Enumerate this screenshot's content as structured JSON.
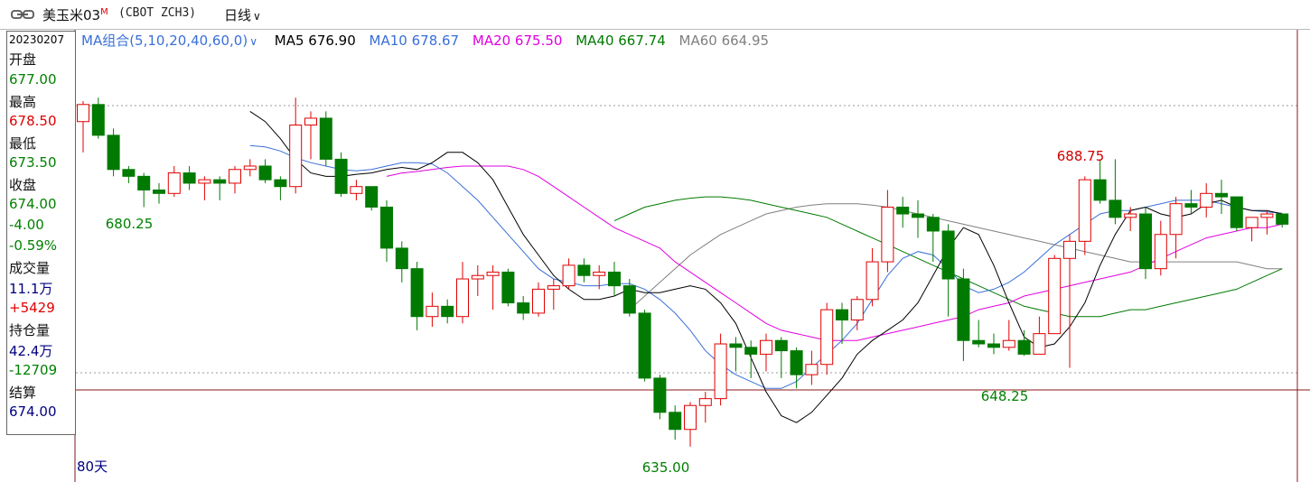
{
  "header": {
    "title": "美玉米03",
    "title_mark": "M",
    "code": "(CBOT ZCH3)",
    "period": "日线"
  },
  "info_panel": {
    "date": "20230207",
    "open_label": "开盘",
    "open": "677.00",
    "high_label": "最高",
    "high": "678.50",
    "low_label": "最低",
    "low": "673.50",
    "close_label": "收盘",
    "close": "674.00",
    "change": "-4.00",
    "change_pct": "-0.59%",
    "volume_label": "成交量",
    "volume": "11.1万",
    "volume_change": "+5429",
    "oi_label": "持仓量",
    "oi": "42.4万",
    "oi_change": "-12709",
    "settle_label": "结算",
    "settle": "674.00"
  },
  "ma_legend": {
    "group": "MA组合(5,10,20,40,60,0)",
    "ma5": "MA5 676.90",
    "ma10": "MA10 678.67",
    "ma20": "MA20 675.50",
    "ma40": "MA40 667.74",
    "ma60": "MA60 664.95"
  },
  "colors": {
    "up": "#e00000",
    "down": "#007a00",
    "ma5": "#000000",
    "ma10": "#3a6fd8",
    "ma20": "#e000e0",
    "ma40": "#007a00",
    "ma60": "#808080",
    "value_green": "#008000",
    "value_red": "#e00000",
    "value_blue": "#000080"
  },
  "chart_data": {
    "type": "candlestick",
    "ylim": [
      631,
      695
    ],
    "annotations": {
      "high": "688.75",
      "low": "635.00",
      "left_low": "680.25",
      "mid_low": "648.25"
    },
    "range_label": "80天",
    "reference_price": 674.0,
    "candles": [
      [
        682.5,
        685.0,
        678.0,
        685.5
      ],
      [
        685.0,
        680.5,
        680.0,
        686.0
      ],
      [
        680.5,
        675.5,
        674.5,
        681.5
      ],
      [
        675.5,
        674.5,
        673.5,
        676.0
      ],
      [
        674.5,
        672.5,
        670.0,
        675.0
      ],
      [
        672.5,
        672.0,
        670.5,
        673.5
      ],
      [
        672.0,
        675.0,
        671.5,
        676.0
      ],
      [
        675.0,
        673.5,
        672.5,
        676.0
      ],
      [
        673.5,
        674.0,
        671.0,
        674.5
      ],
      [
        674.0,
        673.5,
        671.0,
        674.5
      ],
      [
        673.5,
        675.5,
        672.0,
        676.0
      ],
      [
        675.5,
        676.0,
        674.5,
        677.0
      ],
      [
        676.0,
        674.0,
        673.5,
        677.0
      ],
      [
        674.0,
        673.0,
        671.0,
        674.5
      ],
      [
        673.0,
        682.0,
        672.0,
        686.0
      ],
      [
        682.0,
        683.0,
        677.0,
        684.0
      ],
      [
        683.0,
        677.0,
        676.0,
        684.0
      ],
      [
        677.0,
        672.0,
        671.5,
        678.0
      ],
      [
        672.0,
        673.0,
        671.0,
        674.0
      ],
      [
        673.0,
        670.0,
        669.5,
        673.0
      ],
      [
        670.0,
        664.0,
        662.0,
        671.0
      ],
      [
        664.0,
        661.0,
        659.0,
        665.0
      ],
      [
        661.0,
        654.0,
        652.0,
        662.0
      ],
      [
        654.0,
        655.5,
        652.5,
        657.5
      ],
      [
        655.5,
        654.0,
        653.0,
        656.5
      ],
      [
        654.0,
        659.5,
        653.0,
        662.0
      ],
      [
        659.5,
        660.0,
        657.0,
        661.5
      ],
      [
        660.0,
        660.5,
        655.0,
        661.5
      ],
      [
        660.5,
        656.0,
        655.5,
        661.0
      ],
      [
        656.0,
        654.5,
        653.5,
        657.0
      ],
      [
        654.5,
        658.0,
        654.0,
        659.0
      ],
      [
        658.0,
        658.5,
        655.0,
        659.5
      ],
      [
        658.5,
        661.5,
        658.0,
        662.5
      ],
      [
        661.5,
        660.0,
        659.0,
        662.5
      ],
      [
        660.0,
        660.5,
        658.0,
        661.5
      ],
      [
        660.5,
        658.5,
        657.0,
        662.0
      ],
      [
        658.5,
        654.5,
        654.0,
        659.5
      ],
      [
        654.5,
        645.0,
        644.5,
        655.0
      ],
      [
        645.0,
        640.0,
        639.0,
        645.5
      ],
      [
        640.0,
        637.5,
        636.0,
        641.0
      ],
      [
        637.5,
        641.0,
        635.0,
        641.5
      ],
      [
        641.0,
        642.0,
        638.5,
        643.0
      ],
      [
        642.0,
        650.0,
        641.0,
        651.5
      ],
      [
        650.0,
        649.5,
        646.0,
        651.0
      ],
      [
        649.5,
        648.5,
        645.0,
        650.5
      ],
      [
        648.5,
        650.5,
        646.0,
        651.5
      ],
      [
        650.5,
        649.0,
        645.0,
        651.0
      ],
      [
        649.0,
        645.5,
        643.5,
        649.5
      ],
      [
        645.5,
        647.0,
        644.0,
        649.0
      ],
      [
        647.0,
        655.0,
        645.5,
        656.0
      ],
      [
        655.0,
        653.5,
        650.0,
        656.0
      ],
      [
        653.5,
        656.5,
        652.0,
        657.0
      ],
      [
        656.5,
        662.0,
        655.5,
        664.0
      ],
      [
        662.0,
        670.0,
        660.5,
        672.5
      ],
      [
        670.0,
        669.0,
        667.0,
        671.5
      ],
      [
        669.0,
        668.5,
        665.5,
        671.0
      ],
      [
        668.5,
        666.5,
        662.0,
        669.0
      ],
      [
        666.5,
        659.5,
        654.0,
        667.5
      ],
      [
        659.5,
        650.5,
        647.5,
        661.0
      ],
      [
        650.5,
        650.0,
        649.5,
        653.5
      ],
      [
        650.0,
        649.5,
        648.5,
        651.5
      ],
      [
        649.5,
        650.5,
        649.0,
        653.5
      ],
      [
        650.5,
        648.5,
        648.25,
        652.0
      ],
      [
        648.5,
        651.5,
        649.0,
        654.0
      ],
      [
        651.5,
        662.5,
        651.5,
        663.0
      ],
      [
        662.5,
        665.0,
        646.5,
        666.0
      ],
      [
        665.0,
        674.0,
        663.0,
        674.5
      ],
      [
        674.0,
        671.0,
        670.5,
        677.0
      ],
      [
        671.0,
        668.5,
        667.5,
        677.0
      ],
      [
        668.5,
        669.0,
        666.5,
        670.0
      ],
      [
        669.0,
        661.0,
        659.5,
        670.0
      ],
      [
        661.0,
        666.0,
        660.0,
        668.0
      ],
      [
        666.0,
        670.5,
        662.5,
        671.5
      ],
      [
        670.5,
        670.0,
        669.0,
        672.5
      ],
      [
        670.0,
        672.0,
        668.5,
        673.5
      ],
      [
        672.0,
        671.5,
        669.0,
        674.0
      ],
      [
        671.5,
        667.0,
        666.5,
        671.5
      ],
      [
        667.0,
        668.5,
        665.0,
        668.5
      ],
      [
        668.5,
        669.0,
        666.0,
        669.5
      ],
      [
        669.0,
        667.5,
        667.0,
        669.0
      ]
    ],
    "ma": {
      "ma5": [
        684.0,
        682.5,
        680.0,
        677.0,
        675.0,
        674.5,
        674.5,
        674.8,
        675.0,
        675.5,
        675.8,
        675.5,
        676.5,
        678.0,
        678.0,
        676.5,
        674.0,
        670.0,
        666.0,
        663.0,
        660.0,
        658.0,
        656.5,
        656.5,
        657.0,
        658.0,
        657.5,
        657.5,
        658.0,
        658.5,
        658.0,
        656.0,
        653.0,
        648.0,
        643.0,
        639.5,
        638.5,
        640.0,
        642.5,
        645.0,
        648.5,
        650.5,
        652.0,
        653.5,
        656.0,
        660.0,
        664.0,
        667.0,
        666.0,
        661.5,
        656.0,
        651.0,
        649.5,
        650.0,
        652.5,
        656.0,
        661.5,
        666.0,
        669.5,
        670.0,
        669.0,
        668.5,
        669.0,
        670.5,
        671.0,
        670.0,
        669.5,
        669.5,
        669.0
      ],
      "ma10": [
        679.0,
        678.8,
        678.2,
        677.2,
        676.5,
        676.0,
        675.5,
        675.3,
        675.5,
        676.0,
        676.5,
        676.5,
        676.3,
        675.0,
        673.0,
        671.0,
        668.5,
        666.0,
        663.5,
        661.0,
        659.5,
        659.0,
        658.5,
        658.5,
        658.8,
        658.8,
        658.0,
        656.5,
        654.5,
        652.0,
        649.0,
        647.0,
        645.5,
        644.5,
        643.5,
        643.5,
        644.5,
        646.5,
        648.5,
        650.5,
        653.0,
        656.5,
        660.0,
        662.5,
        663.5,
        663.0,
        661.0,
        658.5,
        657.5,
        658.0,
        659.0,
        660.5,
        662.5,
        664.5,
        666.0,
        667.5,
        669.0,
        669.5,
        669.5,
        670.0,
        670.5,
        671.0,
        671.0,
        671.0,
        670.5,
        670.0,
        669.5,
        669.3,
        669.1
      ],
      "ma20": [
        674.5,
        675.0,
        675.2,
        675.5,
        675.8,
        676.0,
        676.0,
        676.0,
        676.0,
        675.5,
        674.5,
        673.0,
        671.5,
        670.0,
        668.5,
        667.0,
        666.0,
        665.0,
        664.0,
        662.0,
        660.5,
        659.0,
        657.5,
        656.0,
        654.5,
        653.0,
        652.0,
        651.5,
        651.0,
        650.5,
        650.5,
        650.5,
        651.0,
        651.5,
        652.0,
        652.5,
        653.0,
        653.5,
        654.0,
        655.0,
        655.5,
        656.0,
        657.0,
        657.5,
        658.0,
        658.5,
        659.0,
        659.5,
        660.0,
        660.5,
        661.5,
        662.5,
        663.5,
        664.5,
        665.5,
        666.0,
        666.5,
        667.0,
        667.0,
        667.5
      ],
      "ma40": [
        668.0,
        669.0,
        670.0,
        670.5,
        671.0,
        671.3,
        671.5,
        671.5,
        671.3,
        671.0,
        670.5,
        670.0,
        669.5,
        669.0,
        668.5,
        667.5,
        666.5,
        665.5,
        664.5,
        663.5,
        662.5,
        661.5,
        660.5,
        659.5,
        658.5,
        657.5,
        656.5,
        655.5,
        655.0,
        654.5,
        654.0,
        654.0,
        654.0,
        654.5,
        655.0,
        655.0,
        655.5,
        656.0,
        656.5,
        657.0,
        657.5,
        658.0,
        659.0,
        660.0,
        661.0
      ],
      "ma60": [
        655.0,
        657.0,
        659.0,
        661.0,
        663.0,
        664.5,
        666.0,
        667.0,
        668.0,
        669.0,
        669.5,
        670.0,
        670.3,
        670.5,
        670.5,
        670.5,
        670.3,
        670.0,
        669.5,
        669.0,
        668.5,
        668.0,
        667.5,
        667.0,
        666.5,
        666.0,
        665.5,
        665.0,
        664.5,
        664.0,
        663.5,
        663.0,
        662.5,
        662.0,
        662.0,
        662.0,
        662.0,
        662.0,
        662.0,
        662.0,
        662.0,
        661.5,
        661.0,
        661.0
      ]
    }
  }
}
